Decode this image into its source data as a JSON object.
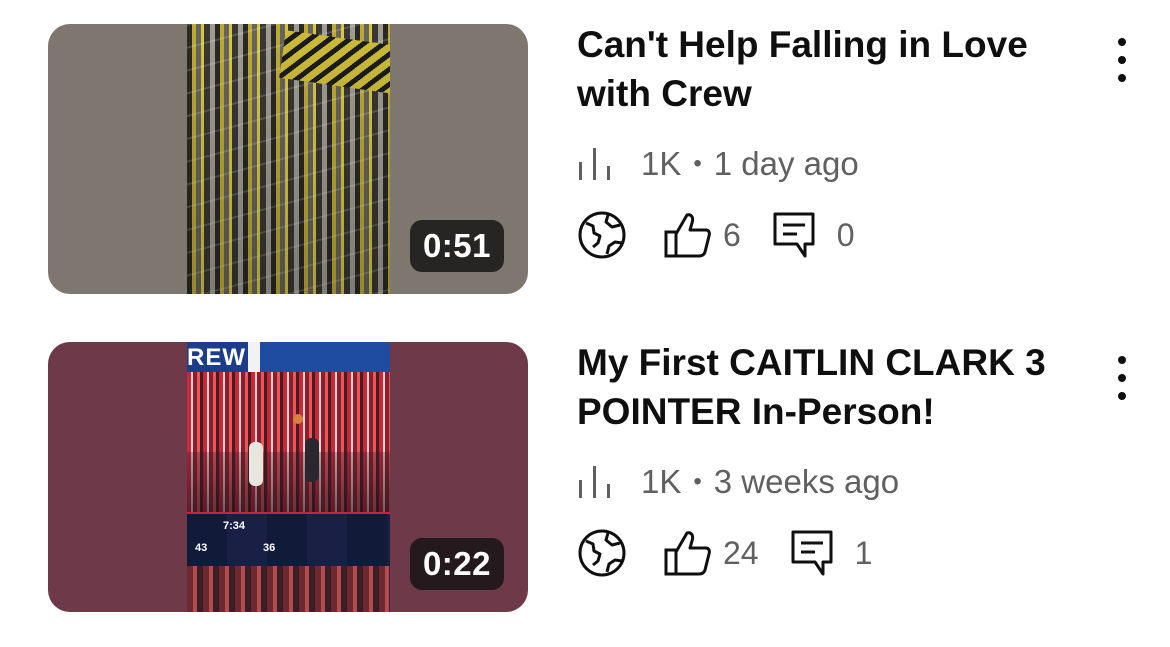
{
  "videos": [
    {
      "title": "Can't Help Falling in Love with Crew",
      "duration": "0:51",
      "views": "1K",
      "separator": "•",
      "age": "1 day ago",
      "likes": "6",
      "comments": "0",
      "visibility_icon": "globe-icon",
      "thumbnail_bg": "#7d776f"
    },
    {
      "title": "My First CAITLIN CLARK 3 POINTER In-Person!",
      "duration": "0:22",
      "views": "1K",
      "separator": "•",
      "age": "3 weeks ago",
      "likes": "24",
      "comments": "1",
      "visibility_icon": "globe-icon",
      "thumbnail_bg": "#6e3a4a",
      "thumbnail_text": {
        "jumbotron": "REW",
        "scoreboard_time": "7:34",
        "score_home": "43",
        "score_away": "36"
      }
    }
  ],
  "colors": {
    "title": "#0f0f0f",
    "secondary_text": "#606060",
    "duration_badge": "#141414"
  }
}
